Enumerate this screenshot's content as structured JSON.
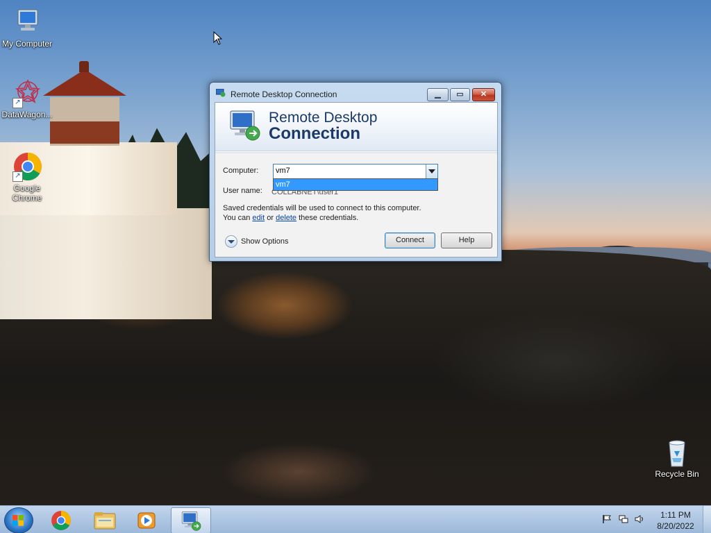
{
  "desktop": {
    "icons": [
      {
        "label": "My Computer",
        "icon": "computer-icon"
      },
      {
        "label": "DataWagon...",
        "icon": "datawagon-icon"
      },
      {
        "label": "Google Chrome",
        "icon": "chrome-icon"
      },
      {
        "label": "Recycle Bin",
        "icon": "recycle-bin-icon"
      }
    ]
  },
  "window": {
    "title": "Remote Desktop Connection",
    "controls": {
      "minimize": "minimize-icon",
      "maximize": "maximize-icon",
      "close": "close-icon"
    },
    "banner": {
      "line1": "Remote Desktop",
      "line2": "Connection"
    },
    "computer_label": "Computer:",
    "computer_value": "vm7",
    "dropdown_items": [
      "vm7"
    ],
    "username_label": "User name:",
    "username_value": "COLLABNET\\user1",
    "credentials_line1": "Saved credentials will be used to connect to this computer.",
    "credentials_prefix": "You can",
    "edit_link": "edit",
    "or_text": "or",
    "delete_link": "delete",
    "credentials_suffix": "these credentials.",
    "show_options": "Show Options",
    "connect_button": "Connect",
    "help_button": "Help"
  },
  "taskbar": {
    "start": "start-icon",
    "pinned": [
      "chrome-icon",
      "file-explorer-icon",
      "media-player-icon",
      "remote-desktop-icon"
    ],
    "active_item": "remote-desktop-icon",
    "tray": [
      "action-center-flag-icon",
      "network-icon",
      "volume-icon"
    ],
    "time": "1:11 PM",
    "date": "8/20/2022"
  },
  "colors": {
    "banner_text": "#1b3a6b",
    "selection": "#3399ff",
    "link": "#0645ad"
  }
}
